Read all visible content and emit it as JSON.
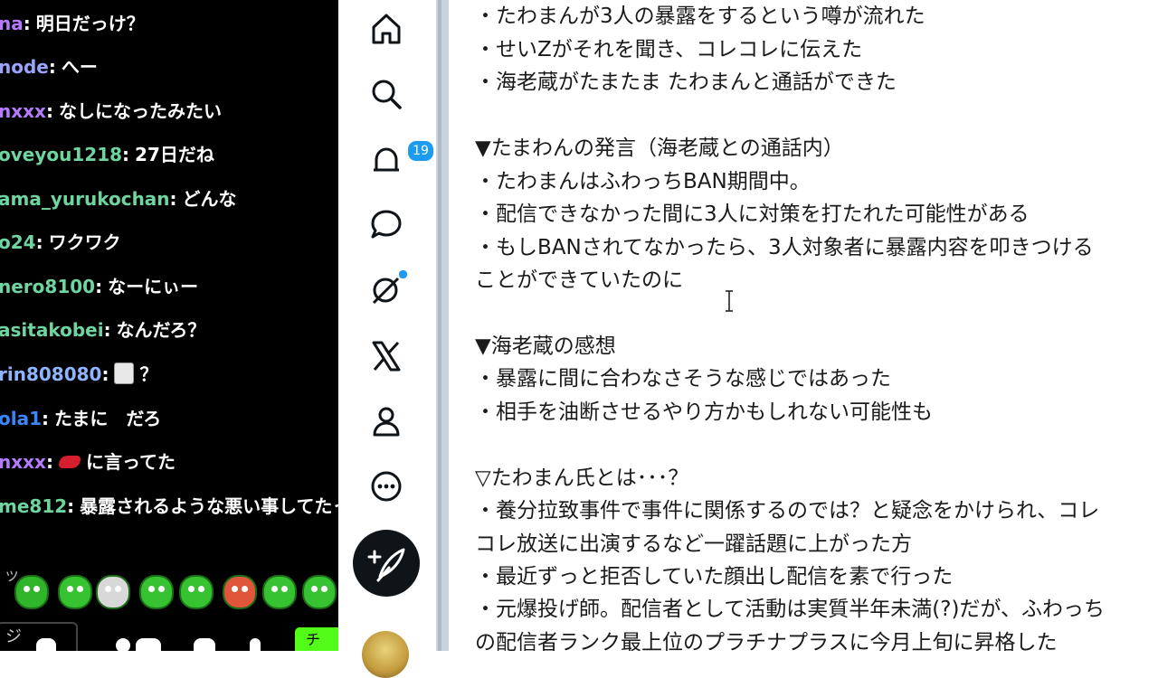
{
  "chat": {
    "messages": [
      {
        "user": "na",
        "color": "#b47bff",
        "text": "明日だっけ？",
        "emote": null
      },
      {
        "user": "node",
        "color": "#9aa4ff",
        "text": "へー",
        "emote": null
      },
      {
        "user": "nxxx",
        "color": "#b47bff",
        "text": "なしになったみたい",
        "emote": null
      },
      {
        "user": "oveyou1218",
        "color": "#6fd5a0",
        "text": "27日だね",
        "emote": null
      },
      {
        "user": "ama_yurukochan",
        "color": "#6fd5a0",
        "text": "どんな",
        "emote": null
      },
      {
        "user": "o24",
        "color": "#6fd5a0",
        "text": "ワクワク",
        "emote": null
      },
      {
        "user": "nero8100",
        "color": "#6fd5a0",
        "text": "なーにぃー",
        "emote": null
      },
      {
        "user": "asitakobei",
        "color": "#6fd5a0",
        "text": "なんだろ？",
        "emote": null
      },
      {
        "user": "rin808080",
        "color": "#8fb4ff",
        "text": "？",
        "emote": "card"
      },
      {
        "user": "ola1",
        "color": "#3a86ff",
        "text": "たまに　だろ",
        "emote": null
      },
      {
        "user": "nxxx",
        "color": "#b47bff",
        "text": "に言ってた",
        "emote": "shrimp"
      },
      {
        "user": "me812",
        "color": "#6fd5a0",
        "text": "暴露されるような悪い事してたっ",
        "emote": null
      }
    ],
    "emote_label": "ッ",
    "input_placeholder": "ジ",
    "send_label": "チ"
  },
  "rail": {
    "notification_count": "19"
  },
  "document": {
    "lines": [
      "・たわまんが3人の暴露をするという噂が流れた",
      "・せいZがそれを聞き、コレコレに伝えた",
      "・海老蔵がたまたま たわまんと通話ができた",
      "",
      "▼たまわんの発言（海老蔵との通話内）",
      "・たわまんはふわっちBAN期間中。",
      "・配信できなかった間に3人に対策を打たれた可能性がある",
      "・もしBANされてなかったら、3人対象者に暴露内容を叩きつける",
      "ことができていたのに",
      "",
      "▼海老蔵の感想",
      "・暴露に間に合わなさそうな感じではあった",
      "・相手を油断させるやり方かもしれない可能性も",
      "",
      "▽たわまん氏とは･･･？",
      "・養分拉致事件で事件に関係するのでは？と疑念をかけられ、コレ",
      "コレ放送に出演するなど一躍話題に上がった方",
      "・最近ずっと拒否していた顔出し配信を素で行った",
      "・元爆投げ師。配信者として活動は実質半年未満(?)だが、ふわっち",
      "の配信者ランク最上位のプラチナプラスに今月上旬に昇格した"
    ]
  }
}
